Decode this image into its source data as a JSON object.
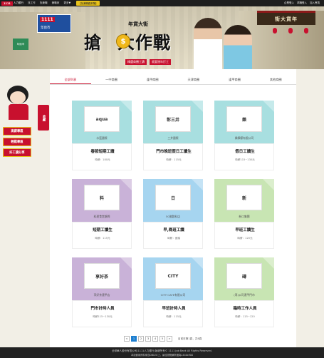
{
  "topbar": {
    "logo": "1111",
    "logo_suffix": "人力銀行",
    "nav": [
      "找工作",
      "找兼職",
      "兼職家",
      "更多▼"
    ],
    "promo": "【找兼職趣來賺】",
    "right": [
      "企業登入",
      "求職登入",
      "加入會員"
    ]
  },
  "banner": {
    "job_sign": "1111",
    "town_sign": "年街市",
    "green_sign": "年街市",
    "gate_text": "街大貨年",
    "title_sub": "年貨大街",
    "title_main_left": "搶",
    "title_coin": "$",
    "title_main_right": "大作戰",
    "badge1": "精選商圈工讀",
    "badge2": "就愛過年打工"
  },
  "left_float": {
    "collect": "收藏",
    "links": [
      "高薪專區",
      "輕鬆專區",
      "好工讀分享"
    ]
  },
  "tabs": [
    "全部列表",
    "一中商圈",
    "逢甲商圈",
    "天津商圈",
    "逢甲商圈",
    "其他商圈"
  ],
  "colors": {
    "teal": "#a8dfe0",
    "purple": "#c9b2d8",
    "green": "#c8e5b3",
    "blue": "#a6d5f0",
    "red": "#c8102e"
  },
  "cards": [
    {
      "logo": "aqua",
      "company": "水藍國際",
      "title": "春節短期工讀",
      "pay": "時薪：180元",
      "color": "#a8dfe0"
    },
    {
      "logo": "彰三井",
      "company": "三井國際",
      "title": "門市晚班假日工讀生",
      "pay": "時薪：115元",
      "color": "#a8dfe0"
    },
    {
      "logo": "樂",
      "company": "樂檸檬有限公司",
      "title": "假日工讀生",
      "pay": "時薪115~130元",
      "color": "#a8dfe0"
    },
    {
      "logo": "料",
      "company": "料理食堂顧問",
      "title": "短期工讀生",
      "pay": "時薪：115元",
      "color": "#c9b2d8"
    },
    {
      "logo": "日",
      "company": "50嵐飲料店",
      "title": "早,晚班工讀",
      "pay": "時薪：面議",
      "color": "#a6d5f0"
    },
    {
      "logo": "新",
      "company": "新口集團",
      "title": "早班工讀生",
      "pay": "時薪：120元",
      "color": "#c8e5b3"
    },
    {
      "logo": "享好茶",
      "company": "享好茶連甲店",
      "title": "門市計時人員",
      "pay": "時薪115~130元",
      "color": "#c9b2d8"
    },
    {
      "logo": "CITY",
      "company": "CITY CAFE有限公司",
      "title": "早班計時人員",
      "pay": "時薪：115元",
      "color": "#a6d5f0"
    },
    {
      "logo": "磚",
      "company": "(專)公司連甲門市",
      "title": "臨時工作人員",
      "pay": "時薪：115~120",
      "color": "#c8e5b3"
    }
  ],
  "pager": {
    "prev": "<",
    "pages": [
      "1",
      "2",
      "3",
      "4",
      "5"
    ],
    "next": ">",
    "info": "目前在第1頁，共6頁"
  },
  "footer": {
    "line1": "全球華人股份有限公司(1111人力銀行)版權所有© 1111 Job Bank All Rights Reserved.",
    "line2": "本站使用資料來自DBLEU上，最佳瀏覽解析度為1440x900"
  }
}
